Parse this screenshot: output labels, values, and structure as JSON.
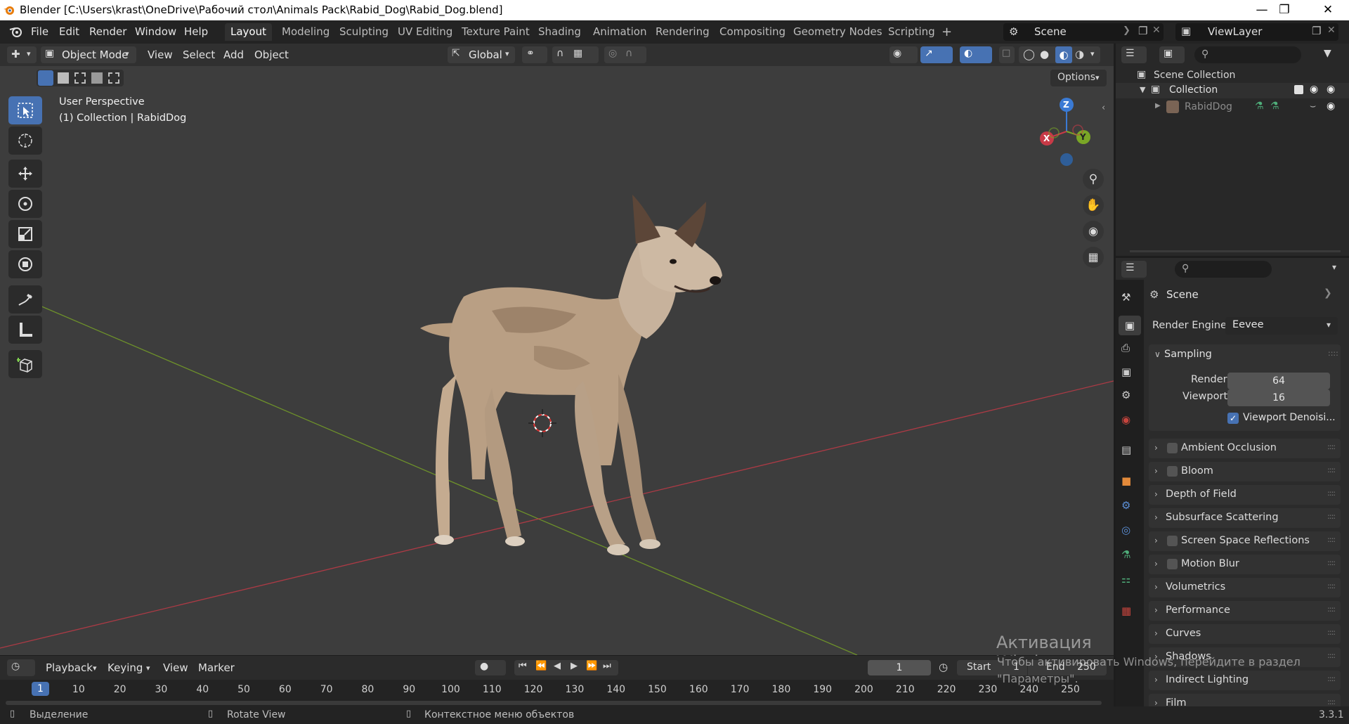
{
  "window": {
    "title": "Blender [C:\\Users\\krast\\OneDrive\\Рабочий стол\\Animals Pack\\Rabid_Dog\\Rabid_Dog.blend]"
  },
  "menu": {
    "items": [
      "File",
      "Edit",
      "Render",
      "Window",
      "Help"
    ]
  },
  "workspaces": [
    "Layout",
    "Modeling",
    "Sculpting",
    "UV Editing",
    "Texture Paint",
    "Shading",
    "Animation",
    "Rendering",
    "Compositing",
    "Geometry Nodes",
    "Scripting"
  ],
  "active_workspace": "Layout",
  "scene_selector": "Scene",
  "view_layer": "ViewLayer",
  "viewport_header": {
    "mode": "Object Mode",
    "menus": [
      "View",
      "Select",
      "Add",
      "Object"
    ],
    "transform_orientation": "Global",
    "options_label": "Options"
  },
  "viewport_overlay": {
    "line1": "User Perspective",
    "line2": "(1) Collection | RabidDog"
  },
  "gizmo": {
    "z": "Z",
    "x": "X",
    "y": "Y"
  },
  "outliner": {
    "scene_collection": "Scene Collection",
    "collection": "Collection",
    "object": "RabidDog"
  },
  "properties": {
    "scene_label": "Scene",
    "render_engine_label": "Render Engine",
    "render_engine_value": "Eevee",
    "sampling_label": "Sampling",
    "render_label": "Render",
    "render_value": "64",
    "viewport_label": "Viewport",
    "viewport_value": "16",
    "viewport_denoise_label": "Viewport Denoisi...",
    "panels": [
      {
        "label": "Ambient Occlusion",
        "checkbox": true
      },
      {
        "label": "Bloom",
        "checkbox": true
      },
      {
        "label": "Depth of Field",
        "checkbox": false
      },
      {
        "label": "Subsurface Scattering",
        "checkbox": false
      },
      {
        "label": "Screen Space Reflections",
        "checkbox": true
      },
      {
        "label": "Motion Blur",
        "checkbox": true
      },
      {
        "label": "Volumetrics",
        "checkbox": false
      },
      {
        "label": "Performance",
        "checkbox": false
      },
      {
        "label": "Curves",
        "checkbox": false
      },
      {
        "label": "Shadows",
        "checkbox": false
      },
      {
        "label": "Indirect Lighting",
        "checkbox": false
      },
      {
        "label": "Film",
        "checkbox": false
      }
    ]
  },
  "timeline": {
    "menus": [
      "Playback",
      "Keying",
      "View",
      "Marker"
    ],
    "current_frame": "1",
    "start_label": "Start",
    "start_value": "1",
    "end_label": "End",
    "end_value": "250",
    "ticks": [
      "1",
      "10",
      "20",
      "30",
      "40",
      "50",
      "60",
      "70",
      "80",
      "90",
      "100",
      "110",
      "120",
      "130",
      "140",
      "150",
      "160",
      "170",
      "180",
      "190",
      "200",
      "210",
      "220",
      "230",
      "240",
      "250"
    ]
  },
  "watermark": {
    "line1": "Активация Windows",
    "line2": "Чтобы активировать Windows, перейдите в раздел",
    "line3": "\"Параметры\"."
  },
  "statusbar": {
    "select": "Выделение",
    "rotate": "Rotate View",
    "context": "Контекстное меню объектов",
    "version": "3.3.1"
  },
  "colors": {
    "accent": "#4772b3",
    "x_axis": "#c83a47",
    "y_axis": "#7aa626",
    "z_axis": "#3a7ad4",
    "viewport_bg": "#3d3d3d"
  }
}
